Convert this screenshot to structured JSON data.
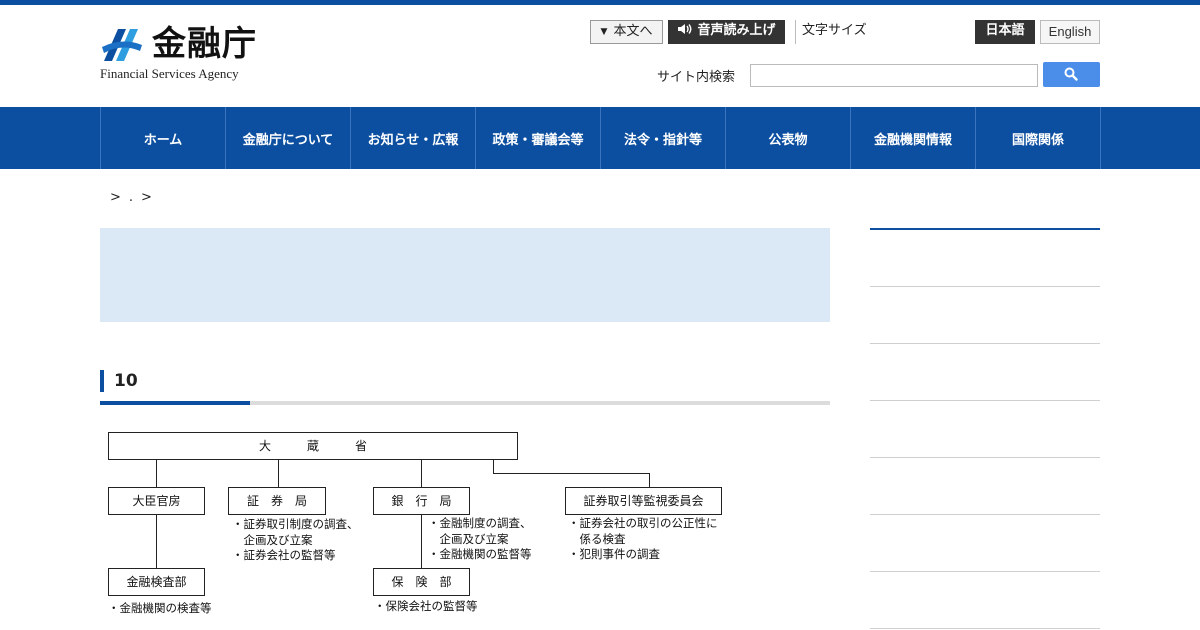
{
  "header": {
    "logo_jp": "金融庁",
    "logo_en": "Financial Services Agency",
    "skip_label": "本文へ",
    "voice_label": "音声読み上げ",
    "fontsize_label": "文字サイズ",
    "lang_ja": "日本語",
    "lang_en": "English",
    "search_label": "サイト内検索",
    "search_value": ""
  },
  "nav": {
    "items": [
      "ホーム",
      "金融庁について",
      "お知らせ・広報",
      "政策・審議会等",
      "法令・指針等",
      "公表物",
      "金融機関情報",
      "国際関係"
    ]
  },
  "breadcrumb": {
    "items": [
      ">",
      ".",
      ">"
    ]
  },
  "section": {
    "title": "10"
  },
  "org_chart": {
    "top": "大　　　蔵　　　省",
    "minister_secretariat": "大臣官房",
    "securities_bureau": "証　券　局",
    "banking_bureau": "銀　行　局",
    "sesc": "証券取引等監視委員会",
    "inspection_dept": "金融検査部",
    "insurance_dept": "保　険　部",
    "securities_notes": [
      "・証券取引制度の調査、",
      "　企画及び立案",
      "・証券会社の監督等"
    ],
    "banking_notes": [
      "・金融制度の調査、",
      "　企画及び立案",
      "・金融機関の監督等"
    ],
    "sesc_notes": [
      "・証券会社の取引の公正性に",
      "　係る検査",
      "・犯則事件の調査"
    ],
    "inspection_notes": [
      "・金融機関の検査等"
    ],
    "insurance_notes": [
      "・保険会社の監督等"
    ]
  }
}
